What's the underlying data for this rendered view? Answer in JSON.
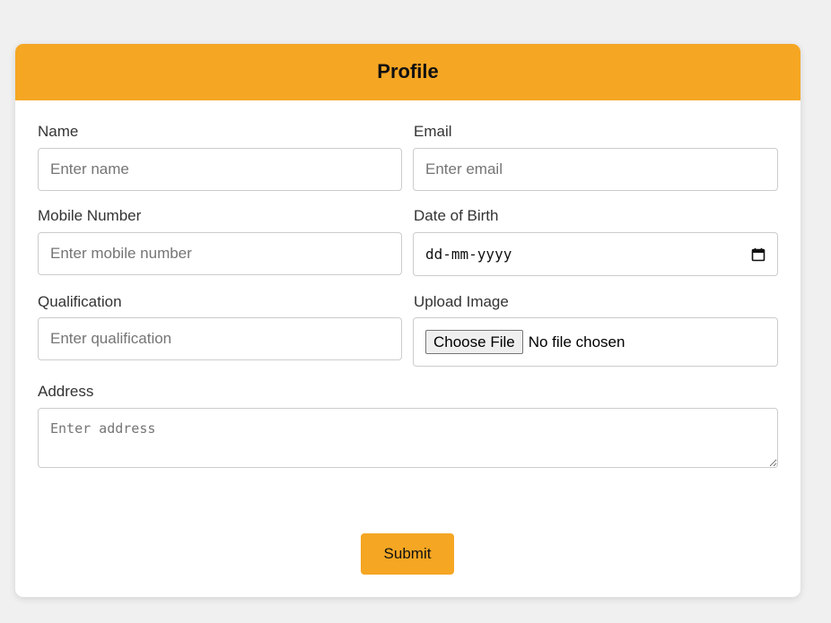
{
  "header": {
    "title": "Profile"
  },
  "form": {
    "name": {
      "label": "Name",
      "placeholder": "Enter name"
    },
    "email": {
      "label": "Email",
      "placeholder": "Enter email"
    },
    "mobile": {
      "label": "Mobile Number",
      "placeholder": "Enter mobile number"
    },
    "dob": {
      "label": "Date of Birth",
      "placeholder": "dd-mm-yyyy"
    },
    "qualification": {
      "label": "Qualification",
      "placeholder": "Enter qualification"
    },
    "image": {
      "label": "Upload Image",
      "button_label": "Choose File",
      "status": "No file chosen"
    },
    "address": {
      "label": "Address",
      "placeholder": "Enter address"
    },
    "submit_label": "Submit"
  },
  "colors": {
    "accent": "#f5a623",
    "background": "#f0f0f0",
    "card": "#ffffff",
    "border": "#cccccc"
  }
}
